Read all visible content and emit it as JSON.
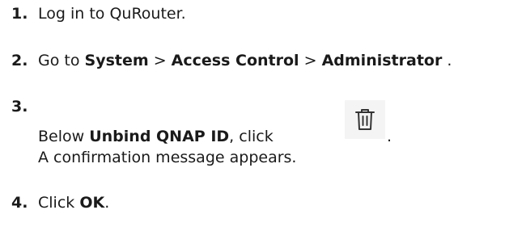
{
  "steps": [
    {
      "number": "1.",
      "text": "Log in to QuRouter."
    },
    {
      "number": "2.",
      "prefix": "Go to ",
      "bold1": "System",
      "sep1": " > ",
      "bold2": "Access Control",
      "sep2": " > ",
      "bold3": "Administrator",
      "suffix": " ."
    },
    {
      "number": "3.",
      "prefix": "Below ",
      "bold1": "Unbind QNAP ID",
      "mid": ", click ",
      "suffix": ".",
      "line2": "A confirmation message appears.",
      "icon": "trash-icon"
    },
    {
      "number": "4.",
      "prefix": "Click ",
      "bold1": "OK",
      "suffix": "."
    }
  ]
}
